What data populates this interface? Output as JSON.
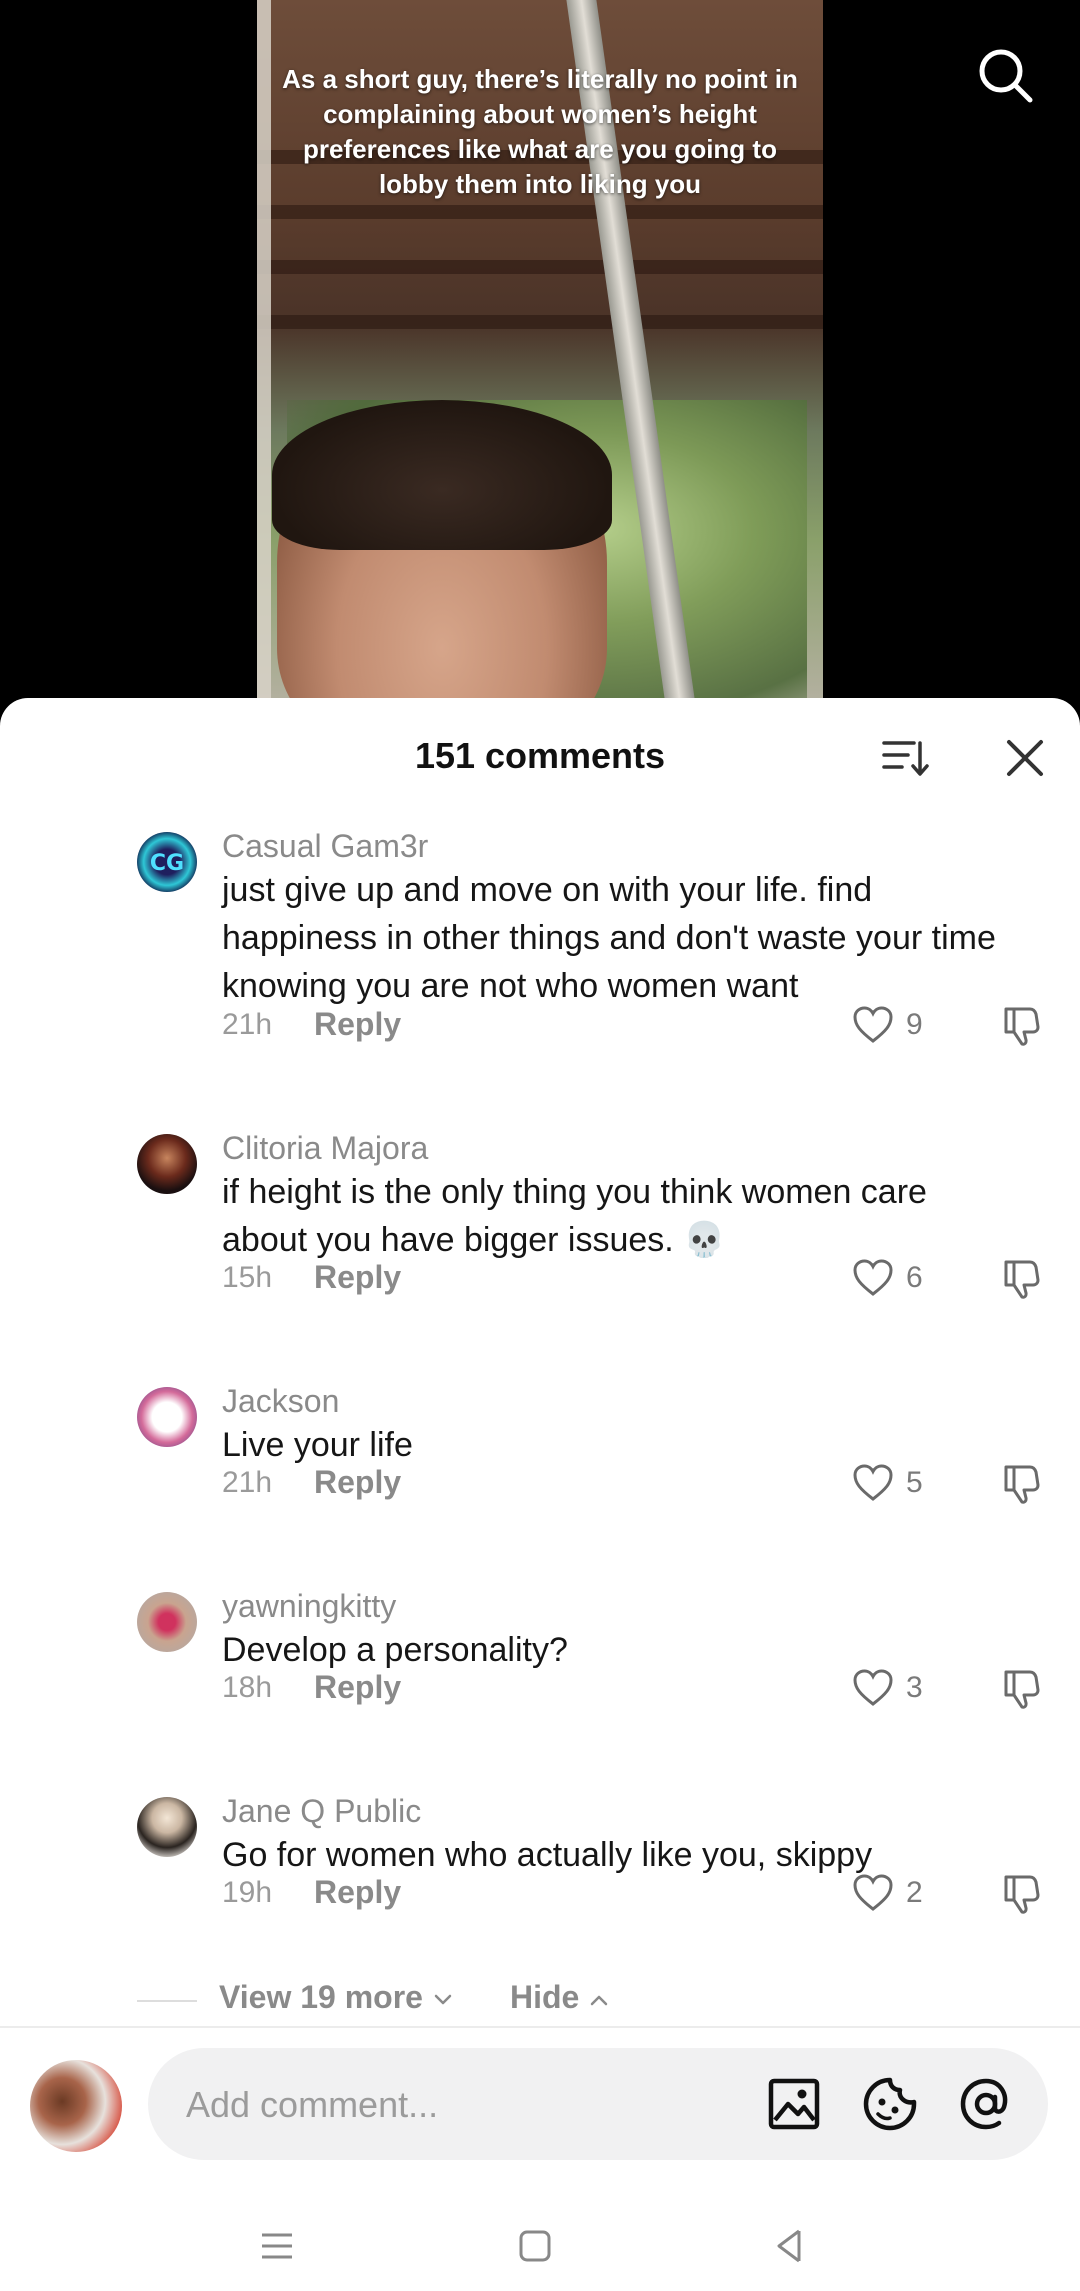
{
  "video": {
    "caption": "As a short guy, there’s literally no point in complaining about women’s height preferences like what are you going to lobby them into liking you"
  },
  "sheet": {
    "title": "151 comments"
  },
  "comments": [
    {
      "name": "Casual Gam3r",
      "text": "just give up and move on with your life. find happiness in other things and don't waste your time knowing you are not who women want",
      "time": "21h",
      "reply": "Reply",
      "likes": "9"
    },
    {
      "name": "Clitoria Majora",
      "text": "if height is the only thing you think women care about you have bigger issues. 💀",
      "time": "15h",
      "reply": "Reply",
      "likes": "6"
    },
    {
      "name": "Jackson",
      "text": "Live your life",
      "time": "21h",
      "reply": "Reply",
      "likes": "5"
    },
    {
      "name": "yawningkitty",
      "text": "Develop a personality?",
      "time": "18h",
      "reply": "Reply",
      "likes": "3"
    },
    {
      "name": "Jane Q Public",
      "text": "Go for women who actually like you, skippy",
      "time": "19h",
      "reply": "Reply",
      "likes": "2"
    }
  ],
  "replies_controls": {
    "view_more": "View 19 more",
    "hide": "Hide"
  },
  "composer": {
    "placeholder": "Add comment..."
  },
  "icons": {
    "search": "search-icon",
    "sort": "sort-icon",
    "close": "close-icon",
    "like": "heart-icon",
    "dislike": "thumbs-down-icon",
    "image": "image-icon",
    "emoji": "emoji-icon",
    "mention": "at-icon"
  }
}
